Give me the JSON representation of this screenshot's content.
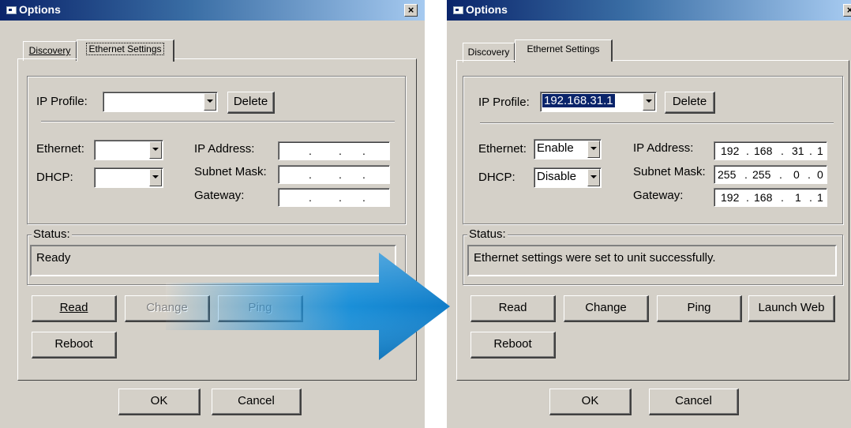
{
  "left": {
    "title": "Options",
    "close": "×",
    "tabs": [
      {
        "label": "Discovery"
      },
      {
        "label": "Ethernet Settings"
      }
    ],
    "ip_profile_label": "IP Profile:",
    "ip_profile_value": "",
    "delete_label": "Delete",
    "ethernet_label": "Ethernet:",
    "ethernet_value": "",
    "dhcp_label": "DHCP:",
    "dhcp_value": "",
    "ip_address_label": "IP Address:",
    "subnet_label": "Subnet Mask:",
    "gateway_label": "Gateway:",
    "ip_address": [
      "",
      "",
      "",
      ""
    ],
    "subnet": [
      "",
      "",
      "",
      ""
    ],
    "gateway": [
      "",
      "",
      "",
      ""
    ],
    "ip_dot": ".",
    "status_label": "Status:",
    "status_text": "Ready",
    "read_label": "Read",
    "change_label": "Change",
    "ping_label": "Ping",
    "reboot_label": "Reboot",
    "ok_label": "OK",
    "cancel_label": "Cancel"
  },
  "right": {
    "title": "Options",
    "close": "×",
    "tabs": [
      {
        "label": "Discovery"
      },
      {
        "label": "Ethernet Settings"
      }
    ],
    "ip_profile_label": "IP Profile:",
    "ip_profile_value": "192.168.31.1",
    "delete_label": "Delete",
    "ethernet_label": "Ethernet:",
    "ethernet_value": "Enable",
    "dhcp_label": "DHCP:",
    "dhcp_value": "Disable",
    "ip_address_label": "IP Address:",
    "subnet_label": "Subnet Mask:",
    "gateway_label": "Gateway:",
    "ip_address": [
      "192",
      "168",
      "31",
      "1"
    ],
    "subnet": [
      "255",
      "255",
      "0",
      "0"
    ],
    "gateway": [
      "192",
      "168",
      "1",
      "1"
    ],
    "ip_dot": ".",
    "status_label": "Status:",
    "status_text": "Ethernet settings were set to unit successfully.",
    "read_label": "Read",
    "change_label": "Change",
    "ping_label": "Ping",
    "launch_web_label": "Launch Web",
    "reboot_label": "Reboot",
    "ok_label": "OK",
    "cancel_label": "Cancel"
  },
  "colors": {
    "titlebar": "#0a246a",
    "face": "#d4d0c8",
    "arrow": "#1a8fd8",
    "selection": "#0a246a"
  },
  "icons": [
    "window-icon",
    "close-icon",
    "chevron-down-icon",
    "right-arrow-graphic"
  ]
}
